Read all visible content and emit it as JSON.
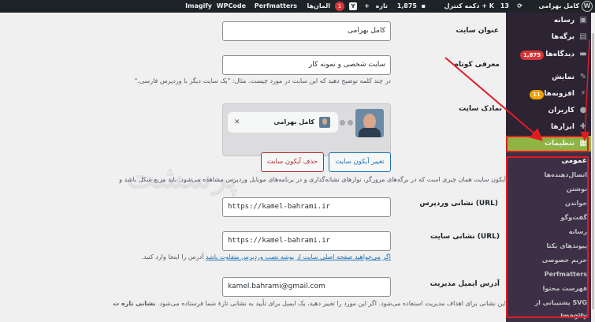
{
  "admin_bar": {
    "site_name": "کامل بهرامی",
    "updates_count": "13",
    "ctrl_button": "دکمه کنترل + K",
    "comments_count": "1,875",
    "new_label": "تازه",
    "yoast_badge": "1",
    "elements_label": "المان‌ها",
    "perfmatters": "Perfmatters",
    "wpcode": "WPCode",
    "imagify": "Imagify"
  },
  "sidebar": {
    "items": [
      {
        "label": "رسانه",
        "icon": "media-icon"
      },
      {
        "label": "برگه‌ها",
        "icon": "pages-icon"
      },
      {
        "label": "دیدگاه‌ها",
        "icon": "comments-icon",
        "count": "1,875"
      },
      {
        "label": "نمایش",
        "icon": "appearance-icon"
      },
      {
        "label": "افزونه‌ها",
        "icon": "plugins-icon",
        "count": "11"
      },
      {
        "label": "کاربران",
        "icon": "users-icon"
      },
      {
        "label": "ابزارها",
        "icon": "tools-icon"
      },
      {
        "label": "تنظیمات",
        "icon": "settings-icon"
      }
    ],
    "submenu": [
      "عمومی",
      "اتصال‌دهنده‌ها",
      "نوشتن",
      "خواندن",
      "گفت‌وگو",
      "رسانه",
      "پیوندهای یکتا",
      "حریم خصوصی",
      "Perfmatters",
      "فهرست محتوا",
      "پشتیبانی از SVG",
      "Imagify"
    ]
  },
  "form": {
    "site_title_label": "عنوان سایت",
    "site_title_value": "کامل بهرامی",
    "tagline_label": "معرفی کوتاه",
    "tagline_value": "سایت شخصی و نمونه کار",
    "tagline_desc": "در چند کلمه توضیح دهید که این سایت در مورد چیست. مثال: \"یک سایت دیگر با وردپرس فارسی.\"",
    "site_icon_label": "نمادک سایت",
    "preview_tab_title": "کامل بهرامی",
    "change_icon_button": "تغییر آیکون سایت",
    "remove_icon_button": "حذف آیکون سایت",
    "site_icon_desc": "آیکون سایت همان چیزی است که در برگه‌های مرورگر، نوارهای نشانه‌گذاری و در برنامه‌های موبایل وردپرس مشاهده می‌شود. باید مربع شکل باشد و",
    "wp_address_label": "نشانی وردپرس (URL)",
    "wp_address_value": "https://kamel-bahrami.ir",
    "site_address_label": "نشانی سایت (URL)",
    "site_address_value": "https://kamel-bahrami.ir",
    "site_address_desc_link": "اگر می‌خواهید صفحه اصلی سایت از پوشه نصب وردپرس متفاوت باشد",
    "site_address_desc_rest": "آدرس را اینجا وارد کنید.",
    "admin_email_label": "آدرس ایمیل مدیریت",
    "admin_email_value": "kamel.bahrami@gmail.com",
    "admin_email_desc": "این نشانی برای اهداف مدیریت استفاده می‌شود. اگر این مورد را تغییر دهید، یک ایمیل برای تأیید به نشانی تازهٔ شما فرستاده می‌شود.",
    "admin_email_desc_bold": "نشانی تازه ت"
  },
  "watermark": "پرسشت",
  "colors": {
    "admin_bar": "#1d2327",
    "sidebar": "#2c2333",
    "active_menu": "#8fb444",
    "highlight": "#e21b23"
  }
}
